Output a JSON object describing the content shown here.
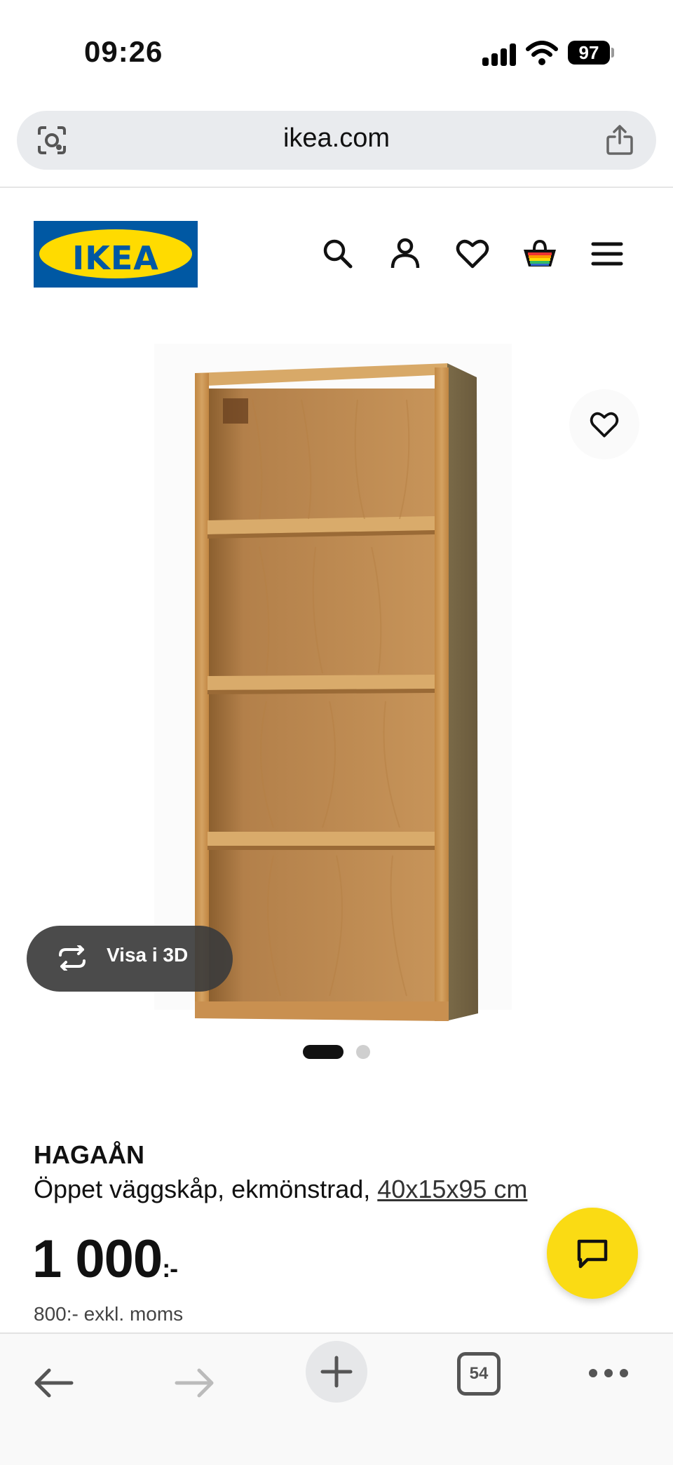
{
  "status_bar": {
    "time": "09:26",
    "battery": "97"
  },
  "browser": {
    "url": "ikea.com",
    "tab_count": "54"
  },
  "header": {
    "logo_text": "IKEA",
    "icons": [
      "search-icon",
      "account-icon",
      "favorites-icon",
      "cart-icon",
      "menu-icon"
    ]
  },
  "product": {
    "name": "HAGAÅN",
    "description": "Öppet väggskåp, ekmönstrad, ",
    "size": "40x15x95 cm",
    "price_main": "1 000",
    "price_suffix": ":-",
    "price_excl_vat": "800:- exkl. moms",
    "view_3d_label": "Visa i 3D",
    "image_count": 2,
    "active_image": 1
  },
  "colors": {
    "ikea_blue": "#0058a3",
    "ikea_yellow": "#ffdb00",
    "chat_yellow": "#fadb14",
    "wood": "#c9934e"
  }
}
